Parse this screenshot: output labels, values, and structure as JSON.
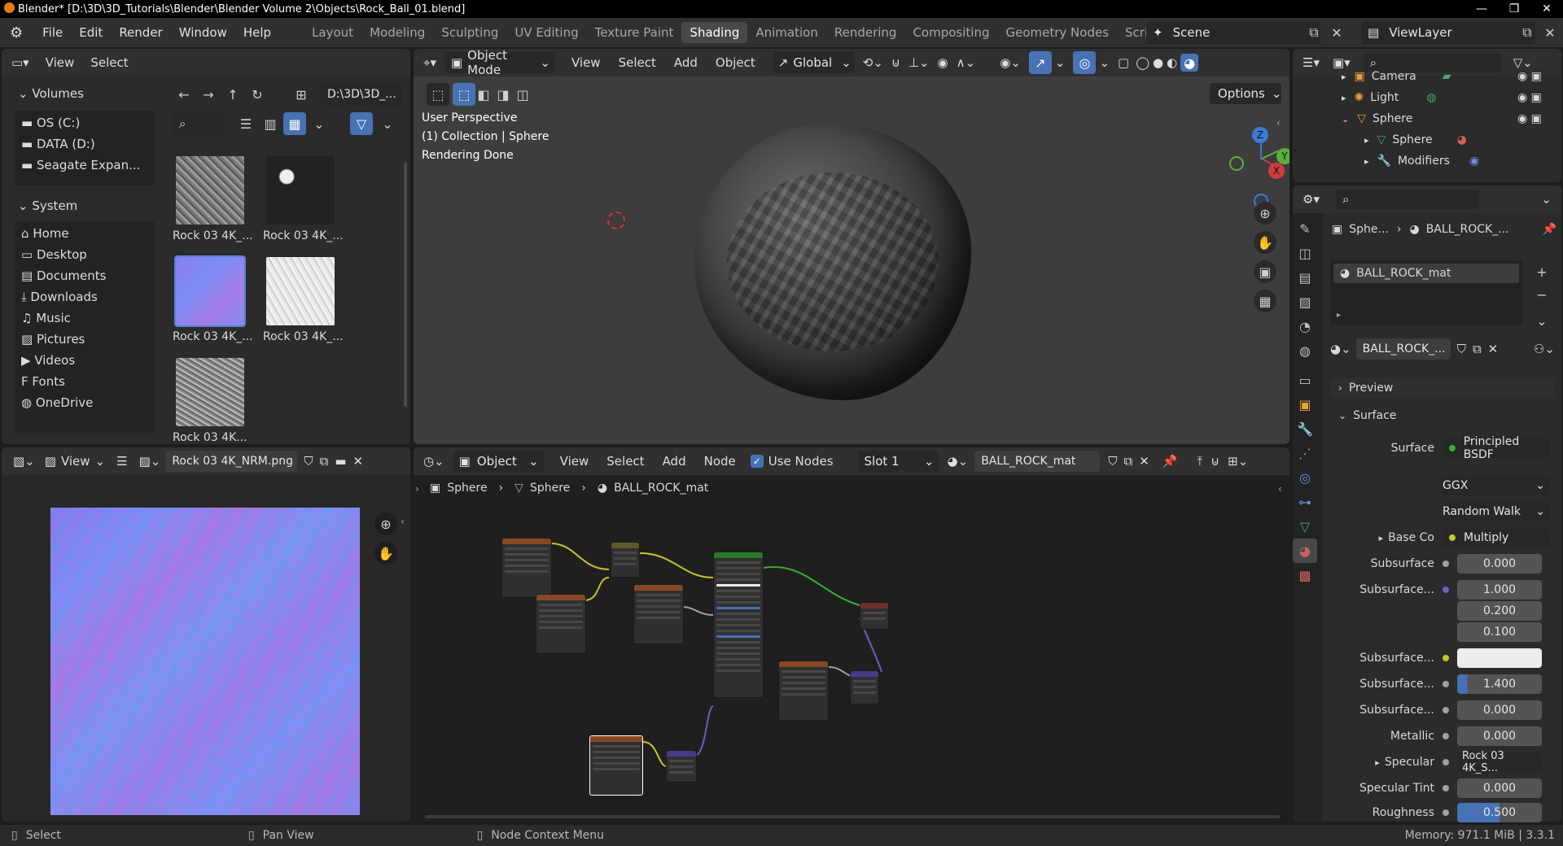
{
  "window": {
    "title": "Blender* [D:\\3D\\3D_Tutorials\\Blender\\Blender Volume 2\\Objects\\Rock_Ball_01.blend]"
  },
  "menus": [
    "File",
    "Edit",
    "Render",
    "Window",
    "Help"
  ],
  "workspaces": [
    "Layout",
    "Modeling",
    "Sculpting",
    "UV Editing",
    "Texture Paint",
    "Shading",
    "Animation",
    "Rendering",
    "Compositing",
    "Geometry Nodes",
    "Scripting"
  ],
  "active_workspace": "Shading",
  "scene": {
    "label": "Scene",
    "view_layer": "ViewLayer"
  },
  "file_browser": {
    "menu": [
      "View",
      "Select"
    ],
    "path": "D:\\3D\\3D_...",
    "volumes_title": "Volumes",
    "volumes": [
      "OS (C:)",
      "DATA (D:)",
      "Seagate Expan..."
    ],
    "system_title": "System",
    "system": [
      "Home",
      "Desktop",
      "Documents",
      "Downloads",
      "Music",
      "Pictures",
      "Videos",
      "Fonts",
      "OneDrive"
    ],
    "files": [
      "Rock 03 4K_...",
      "Rock 03 4K_...",
      "Rock 03 4K_...",
      "Rock 03 4K_...",
      "Rock 03 4K..."
    ]
  },
  "viewport": {
    "mode": "Object Mode",
    "menu": [
      "View",
      "Select",
      "Add",
      "Object"
    ],
    "orientation": "Global",
    "options": "Options",
    "info": [
      "User Perspective",
      "(1) Collection | Sphere",
      "Rendering Done"
    ],
    "gizmo": {
      "z": "Z",
      "y": "Y",
      "x": "X"
    }
  },
  "outliner": {
    "items": [
      {
        "label": "Camera",
        "depth": 1
      },
      {
        "label": "Light",
        "depth": 1
      },
      {
        "label": "Sphere",
        "depth": 1
      },
      {
        "label": "Sphere",
        "depth": 2
      },
      {
        "label": "Modifiers",
        "depth": 2
      }
    ]
  },
  "image_editor": {
    "view": "View",
    "image_name": "Rock 03 4K_NRM.png"
  },
  "node_editor": {
    "type": "Object",
    "menu": [
      "View",
      "Select",
      "Add",
      "Node"
    ],
    "use_nodes": "Use Nodes",
    "slot": "Slot 1",
    "material": "BALL_ROCK_mat",
    "breadcrumb": [
      "Sphere",
      "Sphere",
      "BALL_ROCK_mat"
    ]
  },
  "properties": {
    "breadcrumb": [
      "Sphe...",
      "BALL_ROCK_..."
    ],
    "slot_item": "BALL_ROCK_mat",
    "material_name": "BALL_ROCK_...",
    "sections": {
      "preview": "Preview",
      "surface": "Surface"
    },
    "rows": [
      {
        "label": "Surface",
        "value": "Principled BSDF",
        "dot": "#35b030"
      },
      {
        "label": "",
        "value": "GGX",
        "dot": ""
      },
      {
        "label": "",
        "value": "Random Walk",
        "dot": ""
      },
      {
        "label": "Base Co",
        "value": "Multiply",
        "dot": "#c7c729"
      },
      {
        "label": "Subsurface",
        "value": "0.000",
        "dot": "#a1a1a1"
      },
      {
        "label": "Subsurface...",
        "value": "1.000",
        "dot": "#6363c7"
      },
      {
        "label": "",
        "value": "0.200",
        "dot": ""
      },
      {
        "label": "",
        "value": "0.100",
        "dot": ""
      },
      {
        "label": "Subsurface...",
        "value": "",
        "dot": "#c7c729"
      },
      {
        "label": "Subsurface...",
        "value": "1.400",
        "dot": "#a1a1a1"
      },
      {
        "label": "Subsurface...",
        "value": "0.000",
        "dot": "#a1a1a1"
      },
      {
        "label": "Metallic",
        "value": "0.000",
        "dot": "#a1a1a1"
      },
      {
        "label": "Specular",
        "value": "Rock 03 4K_S...",
        "dot": "#a1a1a1"
      },
      {
        "label": "Specular Tint",
        "value": "0.000",
        "dot": "#a1a1a1"
      },
      {
        "label": "Roughness",
        "value": "0.500",
        "dot": "#a1a1a1"
      }
    ]
  },
  "status": {
    "left": [
      "Select",
      "Pan View",
      "Node Context Menu"
    ],
    "right": "Memory: 971.1 MiB | 3.3.1"
  },
  "colors": {
    "accent": "#4772b3",
    "panel": "#2b2b2b",
    "header": "#303030"
  }
}
